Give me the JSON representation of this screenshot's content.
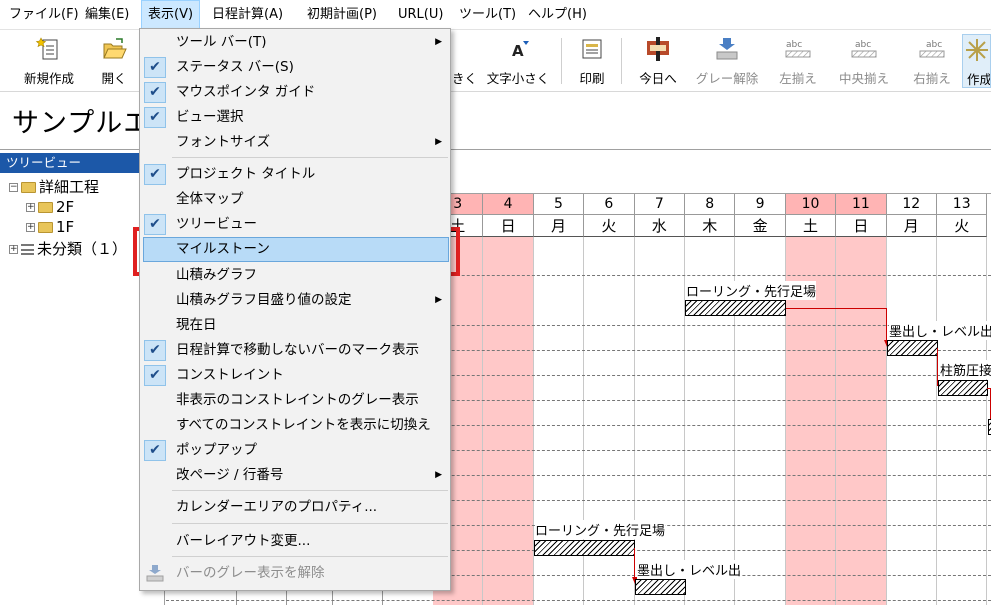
{
  "menubar": {
    "items": [
      "ファイル(F)",
      "編集(E)",
      "表示(V)",
      "日程計算(A)",
      "初期計画(P)",
      "URL(U)",
      "ツール(T)",
      "ヘルプ(H)"
    ]
  },
  "toolbar": {
    "buttons": [
      {
        "label": "新規作成",
        "icon": "new-file-icon"
      },
      {
        "label": "開く",
        "icon": "open-folder-icon"
      },
      {
        "label": "きく",
        "icon": "text-larger-icon"
      },
      {
        "label": "文字小さく",
        "icon": "text-smaller-icon"
      },
      {
        "label": "印刷",
        "icon": "print-icon"
      },
      {
        "label": "今日へ",
        "icon": "today-icon"
      },
      {
        "label": "グレー解除",
        "icon": "ungray-icon"
      },
      {
        "label": "左揃え",
        "icon": "align-left-icon"
      },
      {
        "label": "中央揃え",
        "icon": "align-center-icon"
      },
      {
        "label": "右揃え",
        "icon": "align-right-icon"
      },
      {
        "label": "作成",
        "icon": "create-icon"
      }
    ],
    "abc": "abc"
  },
  "title": {
    "text": "サンプルエ"
  },
  "tree": {
    "header": "ツリービュー",
    "nodes": [
      {
        "label": "詳細工程",
        "expander": "−"
      },
      {
        "label": "2F",
        "expander": "+"
      },
      {
        "label": "1F",
        "expander": "+"
      },
      {
        "label": "未分類（１）",
        "expander": "+"
      }
    ]
  },
  "gantt": {
    "days": [
      {
        "num": "3",
        "wk": "土",
        "holiday": true
      },
      {
        "num": "4",
        "wk": "日",
        "holiday": true
      },
      {
        "num": "5",
        "wk": "月",
        "holiday": false
      },
      {
        "num": "6",
        "wk": "火",
        "holiday": false
      },
      {
        "num": "7",
        "wk": "水",
        "holiday": false
      },
      {
        "num": "8",
        "wk": "木",
        "holiday": false
      },
      {
        "num": "9",
        "wk": "金",
        "holiday": false
      },
      {
        "num": "10",
        "wk": "土",
        "holiday": true
      },
      {
        "num": "11",
        "wk": "日",
        "holiday": true
      },
      {
        "num": "12",
        "wk": "月",
        "holiday": false
      },
      {
        "num": "13",
        "wk": "火",
        "holiday": false
      }
    ],
    "bars": [
      {
        "label": "ローリング・先行足場"
      },
      {
        "label": "墨出し・レベル出"
      },
      {
        "label": "柱筋圧接"
      },
      {
        "label": "ローリング・先行足場"
      },
      {
        "label": "墨出し・レベル出"
      }
    ]
  },
  "dropdown": {
    "items": [
      {
        "label": "ツール バー(T)",
        "checked": false,
        "submenu": true
      },
      {
        "label": "ステータス バー(S)",
        "checked": true,
        "submenu": false
      },
      {
        "label": "マウスポインタ ガイド",
        "checked": true,
        "submenu": false
      },
      {
        "label": "ビュー選択",
        "checked": true,
        "submenu": false
      },
      {
        "label": "フォントサイズ",
        "checked": false,
        "submenu": true
      },
      {
        "label": "プロジェクト タイトル",
        "checked": true,
        "submenu": false
      },
      {
        "label": "全体マップ",
        "checked": false,
        "submenu": false
      },
      {
        "label": "ツリービュー",
        "checked": true,
        "submenu": false
      },
      {
        "label": "マイルストーン",
        "checked": false,
        "submenu": false,
        "highlight": true
      },
      {
        "label": "山積みグラフ",
        "checked": false,
        "submenu": false
      },
      {
        "label": "山積みグラフ目盛り値の設定",
        "checked": false,
        "submenu": true
      },
      {
        "label": "現在日",
        "checked": false,
        "submenu": false
      },
      {
        "label": "日程計算で移動しないバーのマーク表示",
        "checked": true,
        "submenu": false
      },
      {
        "label": "コンストレイント",
        "checked": true,
        "submenu": false
      },
      {
        "label": "非表示のコンストレイントのグレー表示",
        "checked": false,
        "submenu": false
      },
      {
        "label": "すべてのコンストレイントを表示に切換え",
        "checked": false,
        "submenu": false
      },
      {
        "label": "ポップアップ",
        "checked": true,
        "submenu": false
      },
      {
        "label": "改ページ / 行番号",
        "checked": false,
        "submenu": true
      },
      {
        "label": "カレンダーエリアのプロパティ...",
        "checked": false,
        "submenu": false
      },
      {
        "label": "バーレイアウト変更...",
        "checked": false,
        "submenu": false
      },
      {
        "label": "バーのグレー表示を解除",
        "checked": false,
        "submenu": false,
        "disabled": true
      }
    ],
    "check_glyph": "✔",
    "arrow_glyph": "▶"
  },
  "colors": {
    "holiday": "#ffc8c8",
    "menu_highlight": "#b8dbf7",
    "tree_header": "#1c58a8",
    "annotation_red": "#e02020"
  }
}
